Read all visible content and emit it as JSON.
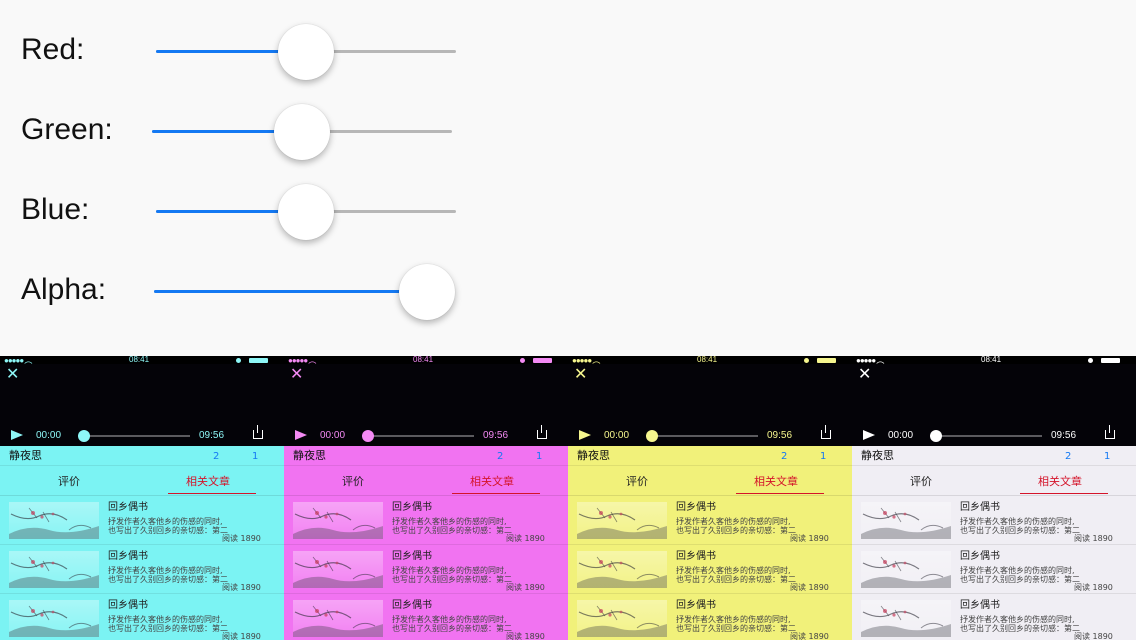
{
  "sliders": [
    {
      "label": "Red:",
      "value": 0.5
    },
    {
      "label": "Green:",
      "value": 0.5
    },
    {
      "label": "Blue:",
      "value": 0.5
    },
    {
      "label": "Alpha:",
      "value": 1.0
    }
  ],
  "colors": {
    "slider_fill": "#1479f3",
    "slider_track": "#b7b7b7",
    "number_blue": "#1479f3",
    "tab_active": "#d4142a"
  },
  "screens": [
    {
      "bg": "#7bf3f3",
      "accent": "#8ef7f7",
      "status_time": "08:41",
      "player": {
        "current": "00:00",
        "duration": "09:56"
      },
      "title": "静夜思",
      "count1": "2",
      "count2": "1",
      "tabs": [
        "评价",
        "相关文章"
      ],
      "items": [
        {
          "title": "回乡偶书",
          "summary_line1": "抒发作者久客他乡的伤感的同时,",
          "summary_line2": "也写出了久别回乡的亲切感：第二",
          "reads": "阅读 1890"
        },
        {
          "title": "回乡偶书",
          "summary_line1": "抒发作者久客他乡的伤感的同时,",
          "summary_line2": "也写出了久别回乡的亲切感：第二",
          "reads": "阅读 1890"
        },
        {
          "title": "回乡偶书",
          "summary_line1": "抒发作者久客他乡的伤感的同时,",
          "summary_line2": "也写出了久别回乡的亲切感：第二",
          "reads": "阅读 1890"
        }
      ]
    },
    {
      "bg": "#f173f1",
      "accent": "#f48af4",
      "status_time": "08:41",
      "player": {
        "current": "00:00",
        "duration": "09:56"
      },
      "title": "静夜思",
      "count1": "2",
      "count2": "1",
      "tabs": [
        "评价",
        "相关文章"
      ],
      "items": [
        {
          "title": "回乡偶书",
          "summary_line1": "抒发作者久客他乡的伤感的同时,",
          "summary_line2": "也写出了久别回乡的亲切感：第二",
          "reads": "阅读 1890"
        },
        {
          "title": "回乡偶书",
          "summary_line1": "抒发作者久客他乡的伤感的同时,",
          "summary_line2": "也写出了久别回乡的亲切感：第二",
          "reads": "阅读 1890"
        },
        {
          "title": "回乡偶书",
          "summary_line1": "抒发作者久客他乡的伤感的同时,",
          "summary_line2": "也写出了久别回乡的亲切感：第二",
          "reads": "阅读 1890"
        }
      ]
    },
    {
      "bg": "#f1f17a",
      "accent": "#f6f68e",
      "status_time": "08:41",
      "player": {
        "current": "00:00",
        "duration": "09:56"
      },
      "title": "静夜思",
      "count1": "2",
      "count2": "1",
      "tabs": [
        "评价",
        "相关文章"
      ],
      "items": [
        {
          "title": "回乡偶书",
          "summary_line1": "抒发作者久客他乡的伤感的同时,",
          "summary_line2": "也写出了久别回乡的亲切感：第二",
          "reads": "阅读 1890"
        },
        {
          "title": "回乡偶书",
          "summary_line1": "抒发作者久客他乡的伤感的同时,",
          "summary_line2": "也写出了久别回乡的亲切感：第二",
          "reads": "阅读 1890"
        },
        {
          "title": "回乡偶书",
          "summary_line1": "抒发作者久客他乡的伤感的同时,",
          "summary_line2": "也写出了久别回乡的亲切感：第二",
          "reads": "阅读 1890"
        }
      ]
    },
    {
      "bg": "#f0eef4",
      "accent": "#ffffff",
      "status_time": "08:41",
      "player": {
        "current": "00:00",
        "duration": "09:56"
      },
      "title": "静夜思",
      "count1": "2",
      "count2": "1",
      "tabs": [
        "评价",
        "相关文章"
      ],
      "items": [
        {
          "title": "回乡偶书",
          "summary_line1": "抒发作者久客他乡的伤感的同时,",
          "summary_line2": "也写出了久别回乡的亲切感：第二",
          "reads": "阅读 1890"
        },
        {
          "title": "回乡偶书",
          "summary_line1": "抒发作者久客他乡的伤感的同时,",
          "summary_line2": "也写出了久别回乡的亲切感：第二",
          "reads": "阅读 1890"
        },
        {
          "title": "回乡偶书",
          "summary_line1": "抒发作者久客他乡的伤感的同时,",
          "summary_line2": "也写出了久别回乡的亲切感：第二",
          "reads": "阅读 1890"
        }
      ]
    }
  ]
}
